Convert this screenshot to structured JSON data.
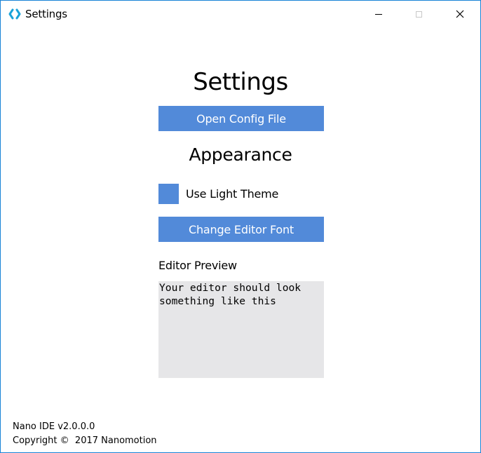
{
  "window": {
    "title": "Settings"
  },
  "icons": {
    "app": "nano-ide-logo-icon",
    "minimize": "minimize-icon",
    "maximize": "maximize-icon",
    "close": "close-icon",
    "close_glyph": "✕"
  },
  "main": {
    "title": "Settings",
    "open_config_label": "Open Config File",
    "appearance_heading": "Appearance",
    "light_theme_label": "Use Light Theme",
    "change_font_label": "Change Editor Font",
    "preview_label": "Editor Preview",
    "preview_text": "Your editor should look\nsomething like this"
  },
  "footer": {
    "version": "Nano IDE v2.0.0.0",
    "copyright": "Copyright ©  2017 Nanomotion"
  },
  "colors": {
    "accent": "#528ad9",
    "window_border": "#1883d7",
    "preview_background": "#e6e6e8",
    "logo": "#1aa3d9"
  }
}
